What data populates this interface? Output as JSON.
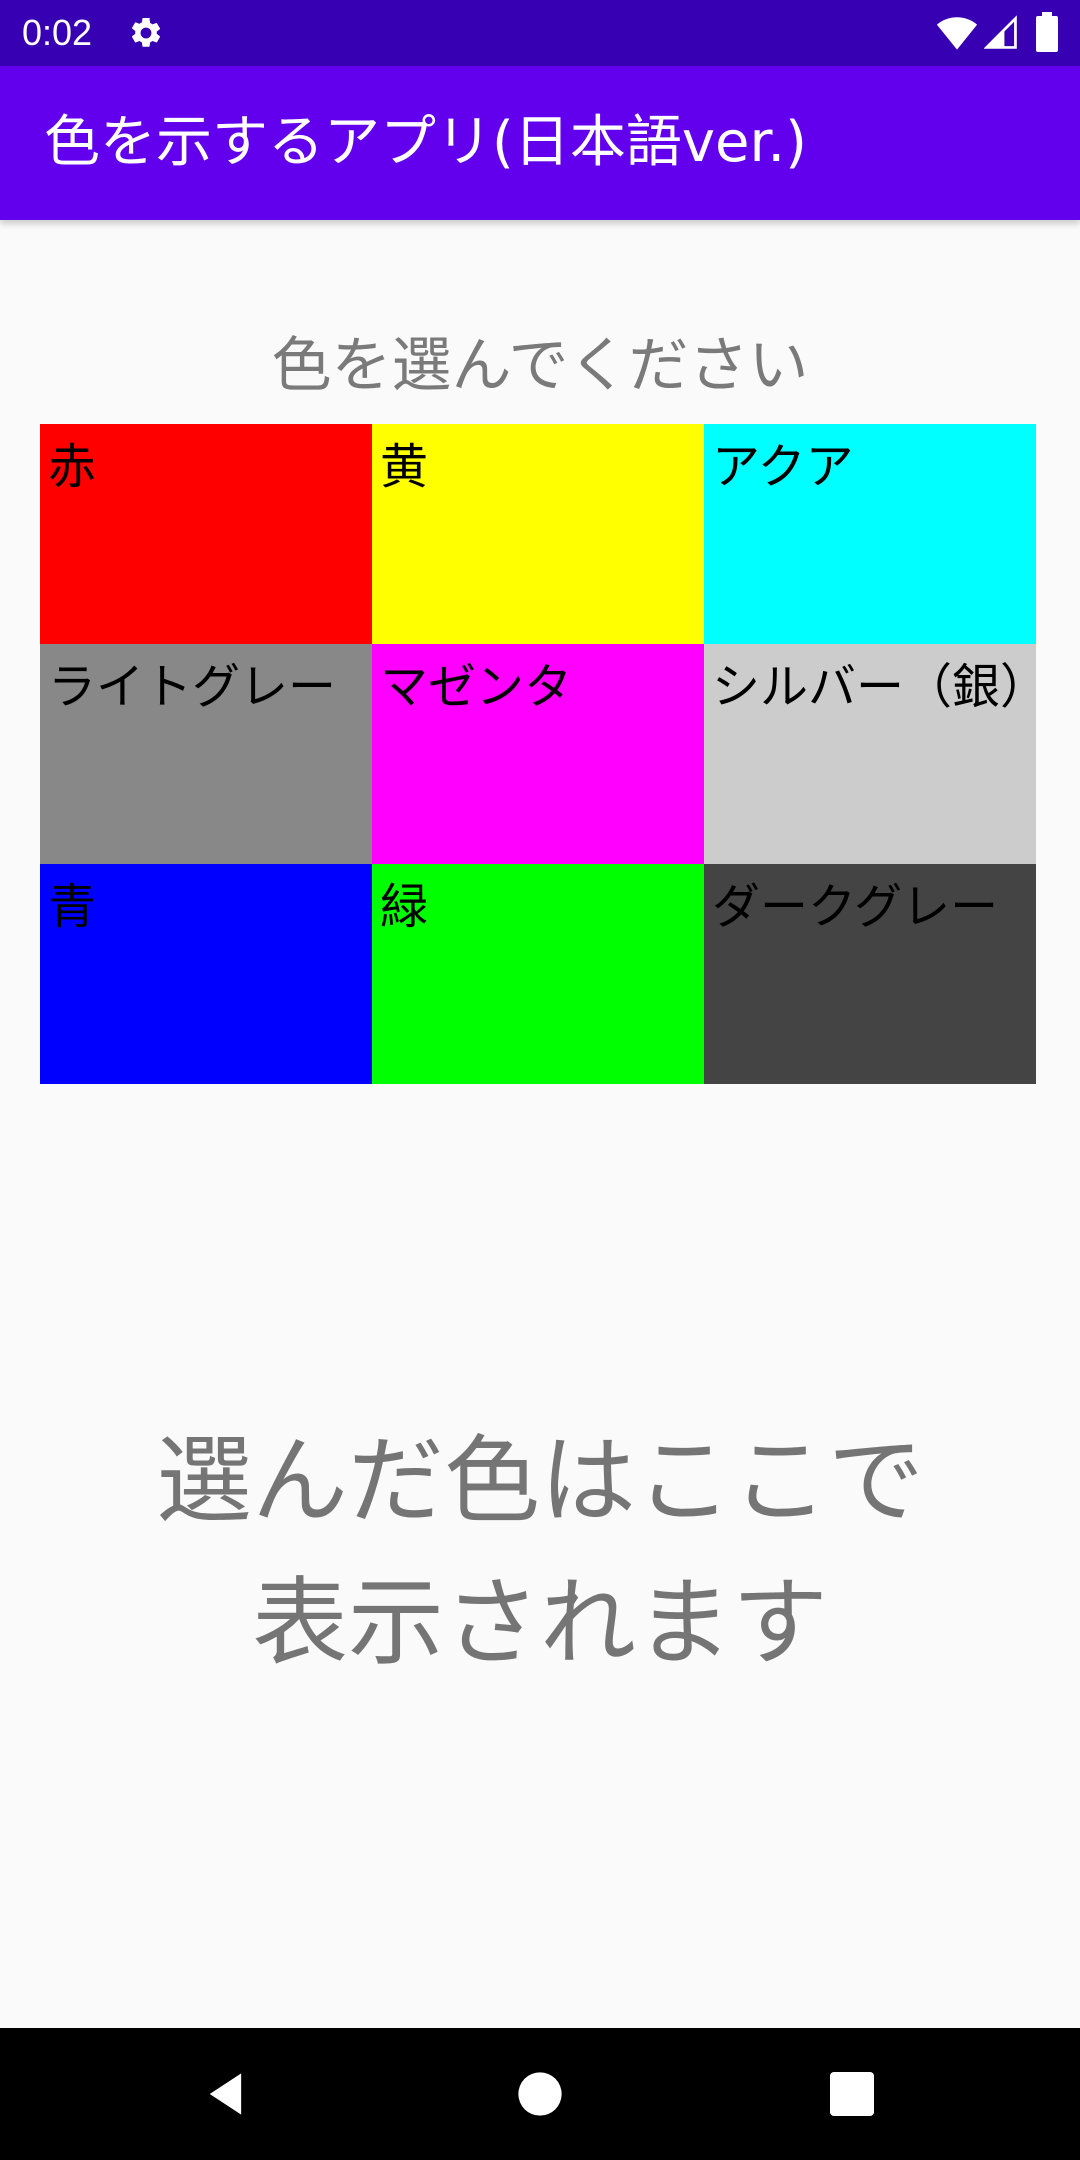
{
  "status_bar": {
    "time": "0:02",
    "icons": [
      "gear-icon",
      "wifi-icon",
      "signal-icon",
      "battery-icon"
    ],
    "background": "#3700b3"
  },
  "app_bar": {
    "title": "色を示するアプリ(日本語ver.)",
    "background": "#6200ee"
  },
  "prompt": "色を選んでください",
  "colors": [
    {
      "label": "赤",
      "color": "#ff0000"
    },
    {
      "label": "黄",
      "color": "#ffff00"
    },
    {
      "label": "アクア",
      "color": "#00ffff"
    },
    {
      "label": "ライトグレー",
      "color": "#888888"
    },
    {
      "label": "マゼンタ",
      "color": "#ff00ff"
    },
    {
      "label": "シルバー（銀）",
      "color": "#cccccc"
    },
    {
      "label": "青",
      "color": "#0000ff"
    },
    {
      "label": "緑",
      "color": "#00ff00"
    },
    {
      "label": "ダークグレー",
      "color": "#444444"
    }
  ],
  "result": {
    "line1": "選んだ色はここで",
    "line2": "表示されます"
  },
  "nav_bar": {
    "icons": [
      "back-icon",
      "home-icon",
      "recent-apps-icon"
    ]
  }
}
